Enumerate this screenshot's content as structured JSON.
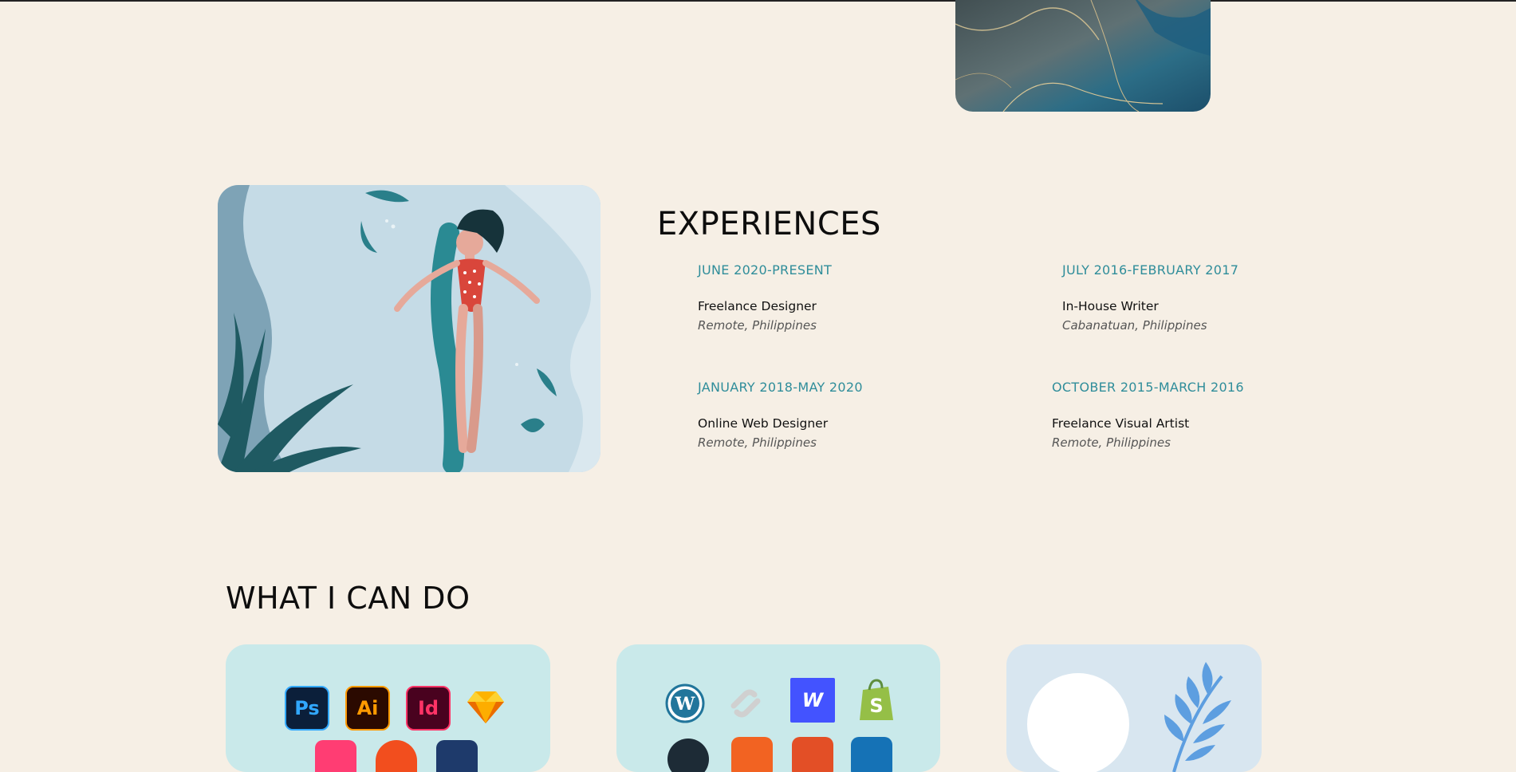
{
  "experiences": {
    "title": "EXPERIENCES",
    "items": [
      {
        "date": "JUNE 2020-PRESENT",
        "role": "Freelance Designer",
        "location": "Remote, Philippines"
      },
      {
        "date": "JULY 2016-FEBRUARY 2017",
        "role": "In-House Writer",
        "location": "Cabanatuan, Philippines"
      },
      {
        "date": "JANUARY 2018-MAY 2020",
        "role": "Online Web Designer",
        "location": "Remote, Philippines"
      },
      {
        "date": "OCTOBER 2015-MARCH 2016",
        "role": "Freelance Visual Artist",
        "location": "Remote, Philippines"
      }
    ]
  },
  "skills": {
    "title": "WHAT I CAN DO",
    "design_icons": [
      {
        "name": "photoshop-icon",
        "label": "Ps"
      },
      {
        "name": "illustrator-icon",
        "label": "Ai"
      },
      {
        "name": "indesign-icon",
        "label": "Id"
      },
      {
        "name": "sketch-icon"
      }
    ],
    "web_icons": [
      {
        "name": "wordpress-icon"
      },
      {
        "name": "squarespace-icon"
      },
      {
        "name": "webflow-icon",
        "label": "W"
      },
      {
        "name": "shopify-icon"
      }
    ]
  },
  "colors": {
    "background": "#f6efe5",
    "accent": "#2f8d9a",
    "card_teal": "#c9e9ea",
    "card_blue": "#d8e6f0"
  }
}
